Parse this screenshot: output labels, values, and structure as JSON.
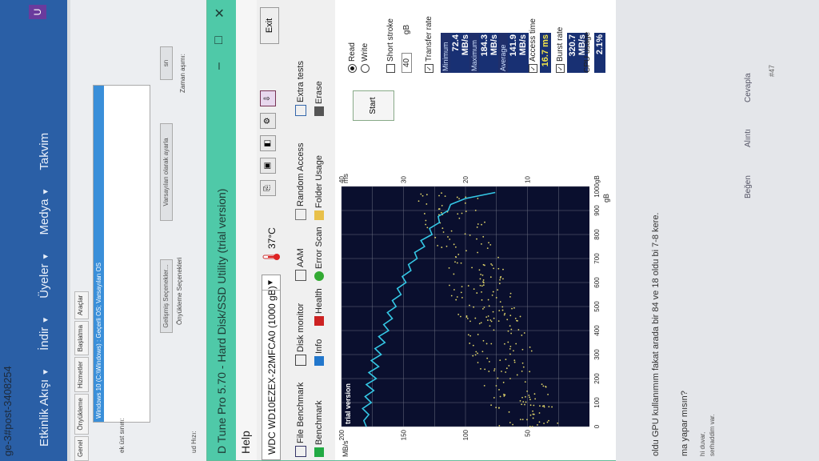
{
  "forum": {
    "url_fragment": "ge-3#post-3408254",
    "menu": [
      "Etkinlik Akışı",
      "İndir",
      "Üyeler",
      "Medya",
      "Takvim"
    ],
    "avatar_letter": "U",
    "post_text": "oldu GPU kullanımım fakat arada bir 84 ve 18 oldu bi 7-8 kere.",
    "question": "ma yapar mısın?",
    "signature_1": "hi duvar,",
    "signature_2": "serhaddim var.",
    "actions": [
      "Beğen",
      "Alıntı",
      "Cevapla"
    ],
    "post_number": "#47"
  },
  "dialog": {
    "tabs": [
      "Genel",
      "Önyükleme",
      "Hizmetler",
      "Başlatma",
      "Araçlar"
    ],
    "os_entry": "Windows 10 (C:\\Windows) : Geçerli OS; Varsayılan OS",
    "advanced": "Gelişmiş Seçenekler...",
    "set_default": "Varsayılan olarak ayarla",
    "timeout_value": "sn",
    "timeout_label": "Zaman aşımı:",
    "boot_options": "Önyükleme Seçenekleri",
    "side_label_1": "ek üst sınırı:",
    "side_label_2": "ud Hızı:"
  },
  "hdtune": {
    "title": "D Tune Pro 5.70 - Hard Disk/SSD Utility (trial version)",
    "menu_help": "Help",
    "drive": "WDC WD10EZEX-22MFCA0 (1000 gB)",
    "temperature": "37°C",
    "exit": "Exit",
    "tabs": [
      "File Benchmark",
      "Benchmark",
      "Disk monitor",
      "Info",
      "Health",
      "AAM",
      "Error Scan",
      "Random Access",
      "Folder Usage",
      "Extra tests",
      "Erase"
    ],
    "panel": {
      "start": "Start",
      "read": "Read",
      "write": "Write",
      "short_stroke": "Short stroke",
      "short_stroke_value": "40",
      "short_stroke_unit": "gB",
      "transfer_rate": "Transfer rate",
      "minimum_label": "Minimum",
      "minimum": "72.4 MB/s",
      "maximum_label": "Maximum",
      "maximum": "184.3 MB/s",
      "average_label": "Average",
      "average": "141.9 MB/s",
      "access_time_label": "Access time",
      "access_time": "16.7 ms",
      "burst_rate_label": "Burst rate",
      "burst_rate": "320.7 MB/s",
      "cpu_usage_label": "CPU usage",
      "cpu_usage": "2.1%"
    }
  },
  "colors": {
    "plot_bg": "#0a0f2e",
    "grid": "#6a6f80",
    "line": "#35c8e6",
    "scatter": "#e3d76a",
    "trial": "#ffffff"
  },
  "chart_data": {
    "type": "line",
    "title": "",
    "watermark": "trial version",
    "xlabel": "gB",
    "x_ticks": [
      0,
      100,
      200,
      300,
      400,
      500,
      600,
      700,
      800,
      900,
      1000
    ],
    "x_tick_labels": [
      "0",
      "100",
      "200",
      "300",
      "400",
      "500",
      "600",
      "700",
      "800",
      "900",
      "1000gB"
    ],
    "xlim": [
      0,
      1000
    ],
    "ylabel_left": "MB/s",
    "ylim_left": [
      0,
      200
    ],
    "y_ticks_left": [
      50,
      100,
      150,
      200
    ],
    "ylabel_right": "ms",
    "ylim_right": [
      0,
      40
    ],
    "y_ticks_right": [
      10,
      20,
      30,
      40
    ],
    "grid": true,
    "series": [
      {
        "name": "Transfer rate",
        "axis": "left",
        "x": [
          0,
          25,
          50,
          75,
          100,
          125,
          150,
          175,
          200,
          225,
          250,
          275,
          300,
          325,
          350,
          375,
          400,
          425,
          450,
          475,
          500,
          525,
          550,
          575,
          600,
          625,
          650,
          675,
          700,
          725,
          750,
          775,
          800,
          825,
          850,
          875,
          900,
          925,
          950,
          975
        ],
        "values": [
          180,
          182,
          178,
          183,
          176,
          181,
          174,
          180,
          172,
          178,
          170,
          176,
          168,
          173,
          165,
          170,
          162,
          166,
          159,
          163,
          156,
          159,
          152,
          155,
          148,
          151,
          144,
          146,
          139,
          141,
          133,
          136,
          127,
          129,
          121,
          122,
          114,
          112,
          100,
          76
        ]
      },
      {
        "name": "Access time",
        "axis": "right",
        "type": "scatter",
        "summary_ms": 16.7
      }
    ]
  }
}
